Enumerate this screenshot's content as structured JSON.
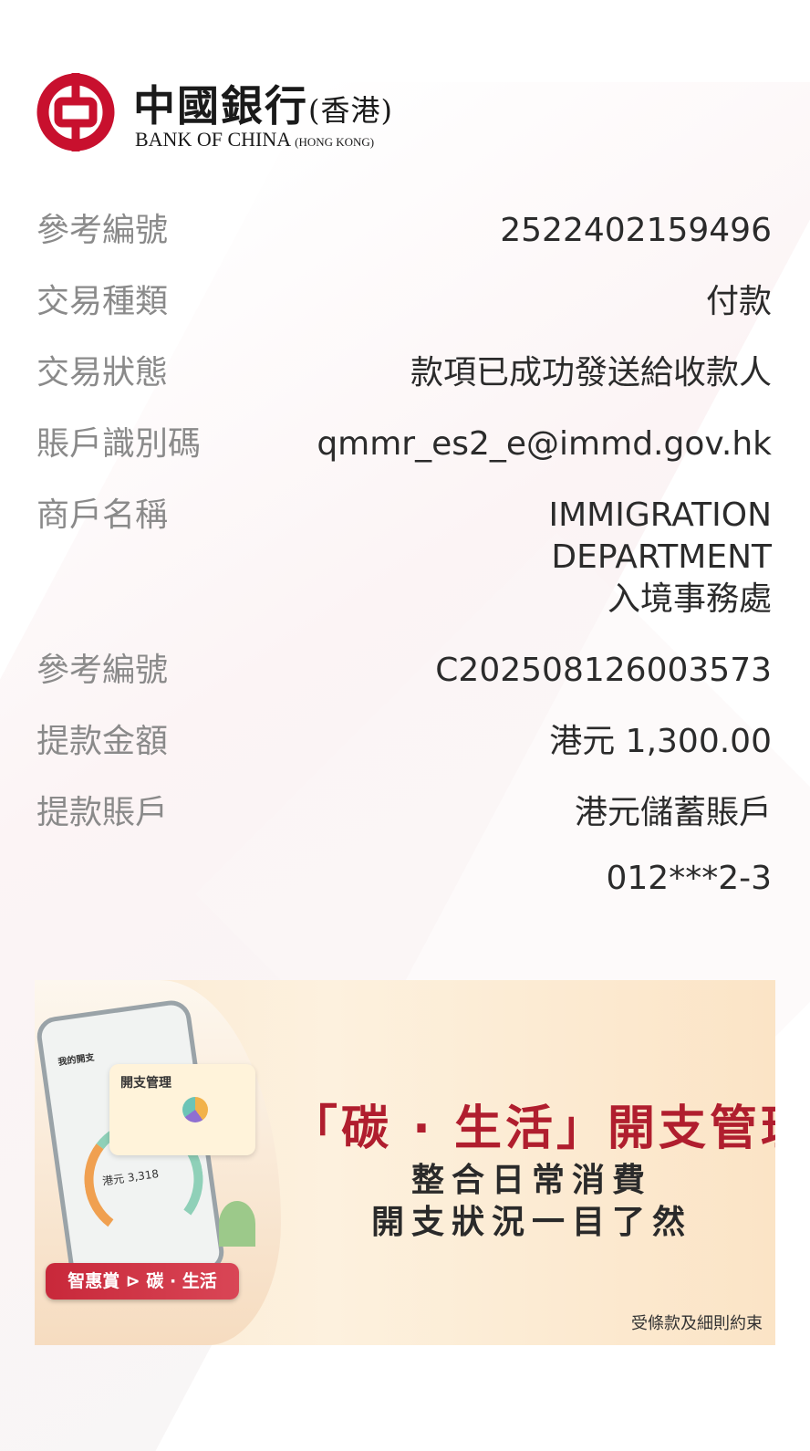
{
  "brand": {
    "name_cn": "中國銀行",
    "region_cn": "(香港)",
    "name_en": "BANK OF CHINA",
    "region_en": "(HONG KONG)"
  },
  "details": [
    {
      "label": "參考編號",
      "value": "2522402159496"
    },
    {
      "label": "交易種類",
      "value": "付款"
    },
    {
      "label": "交易狀態",
      "value": "款項已成功發送給收款人"
    },
    {
      "label": "賬戶識別碼",
      "value": "qmmr_es2_e@immd.gov.hk"
    },
    {
      "label": "商戶名稱",
      "value_lines": [
        "IMMIGRATION",
        "DEPARTMENT",
        "入境事務處"
      ]
    },
    {
      "label": "參考編號",
      "value": "C202508126003573"
    },
    {
      "label": "提款金額",
      "value": "港元 1,300.00"
    },
    {
      "label": "提款賬戶",
      "value": "港元儲蓄賬戶"
    }
  ],
  "account_number": "012***2-3",
  "banner": {
    "title": "「碳 · 生活」開支管理",
    "line1": "整合日常消費",
    "line2": "開支狀況一目了然",
    "note": "受條款及細則約束",
    "tag": "智惠賞 ⊳ 碳 · 生活",
    "card_title": "開支管理",
    "phone_title": "我的開支",
    "phone_amount": "港元 3,318",
    "colors": {
      "accent": "#b01e2e",
      "bg": "#fbe9d2"
    }
  },
  "colors": {
    "brand_red": "#c8102e",
    "label": "#8a8a8a",
    "value": "#2b2b2b"
  }
}
